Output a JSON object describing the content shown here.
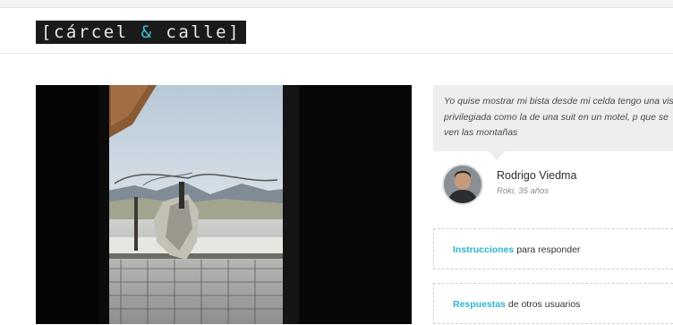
{
  "header": {
    "logo_left": "[cárcel ",
    "logo_amp": "&",
    "logo_right": " calle]",
    "accent_color": "#43c2d6"
  },
  "photo": {
    "alt": "Vista desde la celda hacia las montañas"
  },
  "testimonial": {
    "quote": "Yo quise mostrar mi bista desde mi celda tengo una vista privilegiada como la de una suit en un motel, p que se ven las montañas",
    "author_name": "Rodrigo Viedma",
    "author_meta": "Roki, 35 años"
  },
  "actions": {
    "instructions_link": "Instrucciones",
    "instructions_rest": " para responder",
    "responses_link": "Respuestas",
    "responses_rest": " de otros usuarios",
    "link_color": "#2ab4cf"
  }
}
